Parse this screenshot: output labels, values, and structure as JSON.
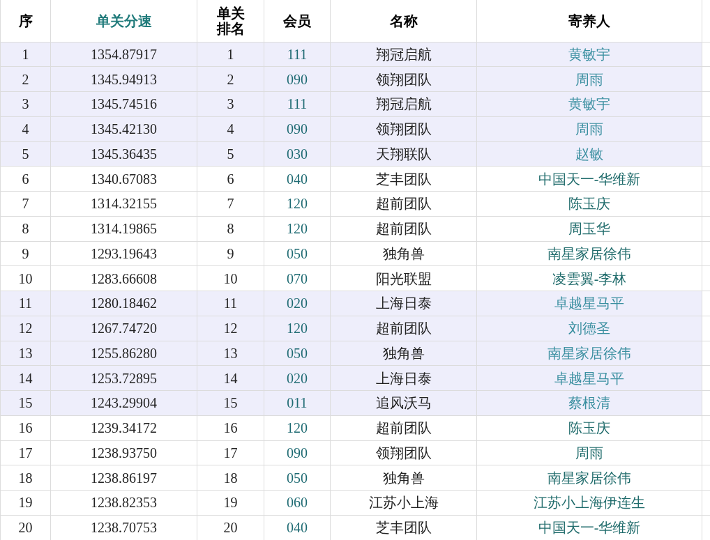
{
  "table": {
    "columns": [
      {
        "label": "序",
        "accent": false
      },
      {
        "label": "单关分速",
        "accent": true
      },
      {
        "label": "单关排名",
        "accent": false
      },
      {
        "label": "会员",
        "accent": false
      },
      {
        "label": "名称",
        "accent": false
      },
      {
        "label": "寄养人",
        "accent": false
      }
    ],
    "rows": [
      {
        "highlighted": true,
        "cells": [
          "1",
          "1354.87917",
          "1",
          "111",
          "翔冠启航",
          "黄敏宇"
        ]
      },
      {
        "highlighted": true,
        "cells": [
          "2",
          "1345.94913",
          "2",
          "090",
          "领翔团队",
          "周雨"
        ]
      },
      {
        "highlighted": true,
        "cells": [
          "3",
          "1345.74516",
          "3",
          "111",
          "翔冠启航",
          "黄敏宇"
        ]
      },
      {
        "highlighted": true,
        "cells": [
          "4",
          "1345.42130",
          "4",
          "090",
          "领翔团队",
          "周雨"
        ]
      },
      {
        "highlighted": true,
        "cells": [
          "5",
          "1345.36435",
          "5",
          "030",
          "天翔联队",
          "赵敏"
        ]
      },
      {
        "highlighted": false,
        "cells": [
          "6",
          "1340.67083",
          "6",
          "040",
          "芝丰团队",
          "中国天一-华维新"
        ]
      },
      {
        "highlighted": false,
        "cells": [
          "7",
          "1314.32155",
          "7",
          "120",
          "超前团队",
          "陈玉庆"
        ]
      },
      {
        "highlighted": false,
        "cells": [
          "8",
          "1314.19865",
          "8",
          "120",
          "超前团队",
          "周玉华"
        ]
      },
      {
        "highlighted": false,
        "cells": [
          "9",
          "1293.19643",
          "9",
          "050",
          "独角兽",
          "南星家居徐伟"
        ]
      },
      {
        "highlighted": false,
        "cells": [
          "10",
          "1283.66608",
          "10",
          "070",
          "阳光联盟",
          "凌雲翼-李林"
        ]
      },
      {
        "highlighted": true,
        "cells": [
          "11",
          "1280.18462",
          "11",
          "020",
          "上海日泰",
          "卓越星马平"
        ]
      },
      {
        "highlighted": true,
        "cells": [
          "12",
          "1267.74720",
          "12",
          "120",
          "超前团队",
          "刘德圣"
        ]
      },
      {
        "highlighted": true,
        "cells": [
          "13",
          "1255.86280",
          "13",
          "050",
          "独角兽",
          "南星家居徐伟"
        ]
      },
      {
        "highlighted": true,
        "cells": [
          "14",
          "1253.72895",
          "14",
          "020",
          "上海日泰",
          "卓越星马平"
        ]
      },
      {
        "highlighted": true,
        "cells": [
          "15",
          "1243.29904",
          "15",
          "011",
          "追风沃马",
          "蔡根清"
        ]
      },
      {
        "highlighted": false,
        "cells": [
          "16",
          "1239.34172",
          "16",
          "120",
          "超前团队",
          "陈玉庆"
        ]
      },
      {
        "highlighted": false,
        "cells": [
          "17",
          "1238.93750",
          "17",
          "090",
          "领翔团队",
          "周雨"
        ]
      },
      {
        "highlighted": false,
        "cells": [
          "18",
          "1238.86197",
          "18",
          "050",
          "独角兽",
          "南星家居徐伟"
        ]
      },
      {
        "highlighted": false,
        "cells": [
          "19",
          "1238.82353",
          "19",
          "060",
          "江苏小上海",
          "江苏小上海伊连生"
        ]
      },
      {
        "highlighted": false,
        "cells": [
          "20",
          "1238.70753",
          "20",
          "040",
          "芝丰团队",
          "中国天一-华维新"
        ]
      }
    ]
  }
}
